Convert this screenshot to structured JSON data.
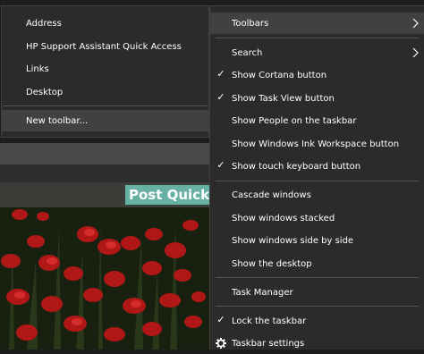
{
  "background": {
    "post_title": "Post Quick R"
  },
  "toolbars_submenu": {
    "items": [
      {
        "label": "Address"
      },
      {
        "label": "HP Support Assistant Quick Access"
      },
      {
        "label": "Links"
      },
      {
        "label": "Desktop"
      },
      {
        "label": "New toolbar..."
      }
    ]
  },
  "taskbar_menu": {
    "toolbars": "Toolbars",
    "search": "Search",
    "show_cortana": "Show Cortana button",
    "show_task_view": "Show Task View button",
    "show_people": "Show People on the taskbar",
    "show_ink": "Show Windows Ink Workspace button",
    "show_touch_keyboard": "Show touch keyboard button",
    "cascade": "Cascade windows",
    "stacked": "Show windows stacked",
    "side_by_side": "Show windows side by side",
    "show_desktop": "Show the desktop",
    "task_manager": "Task Manager",
    "lock_taskbar": "Lock the taskbar",
    "taskbar_settings": "Taskbar settings",
    "checked": [
      "show_cortana",
      "show_task_view",
      "show_touch_keyboard",
      "lock_taskbar"
    ]
  },
  "colors": {
    "menu_bg": "#2b2b2b",
    "menu_hover": "#414141",
    "separator": "#555555",
    "text": "#ffffff",
    "title_accent": "#66b0a4"
  },
  "icons": [
    "checkmark-icon",
    "chevron-right-icon",
    "gear-icon"
  ]
}
